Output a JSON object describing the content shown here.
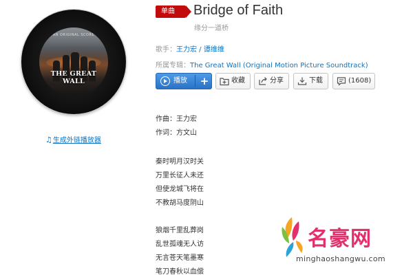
{
  "song": {
    "badge": "单曲",
    "title": "Bridge of Faith",
    "subtitle": "缘分一道桥",
    "artist_label": "歌手：",
    "artists": [
      "王力宏",
      "谭维维"
    ],
    "artist_separator": " / ",
    "album_label": "所属专辑：",
    "album": "The Great Wall (Original Motion Picture Soundtrack)"
  },
  "cover": {
    "top_text": "AN ORIGINAL SCORE",
    "title_text": "THE GREAT WALL"
  },
  "external_link": {
    "label": "生成外链播放器",
    "icon": "music-note-icon"
  },
  "actions": {
    "play": "播放",
    "add": "+",
    "collect": "收藏",
    "share": "分享",
    "download": "下载",
    "comment": "(1608)"
  },
  "lyrics": [
    "作曲：王力宏",
    "作词：方文山",
    "",
    "秦时明月汉时关",
    "万里长征人未还",
    "但使龙城飞将在",
    "不教胡马度阴山",
    "",
    "狼烟千里乱葬岗",
    "乱世孤魂无人访",
    "无言苍天笔墨寒",
    "笔刀春秋以血偿"
  ],
  "watermark": {
    "text": "名豪网",
    "url": "minghaoshangwu.com"
  },
  "colors": {
    "badge": "#c20c0c",
    "link": "#0c73c2",
    "play_button": "#2a72c6",
    "watermark": "#e3306c"
  }
}
